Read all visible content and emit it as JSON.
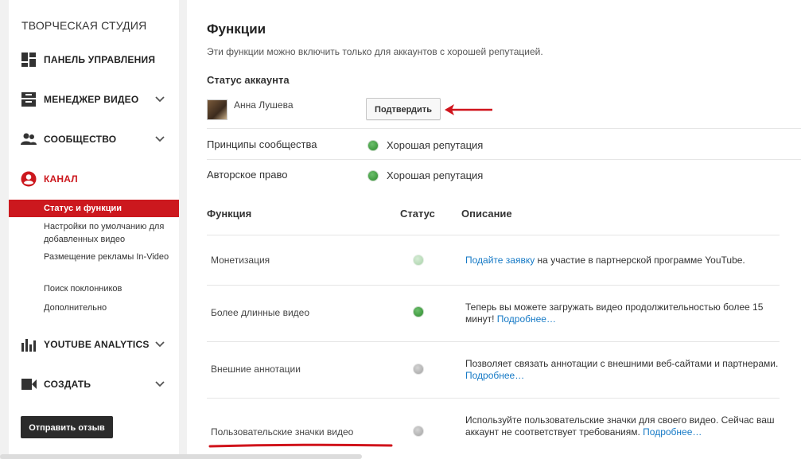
{
  "sidebar": {
    "title": "ТВОРЧЕСКАЯ СТУДИЯ",
    "items": [
      {
        "label": "ПАНЕЛЬ УПРАВЛЕНИЯ",
        "icon": "dashboard-icon"
      },
      {
        "label": "МЕНЕДЖЕР ВИДЕО",
        "icon": "video-manager-icon"
      },
      {
        "label": "СООБЩЕСТВО",
        "icon": "community-icon"
      },
      {
        "label": "КАНАЛ",
        "icon": "channel-icon"
      },
      {
        "label": "YOUTUBE ANALYTICS",
        "icon": "analytics-icon"
      },
      {
        "label": "СОЗДАТЬ",
        "icon": "create-icon"
      }
    ],
    "subitems": [
      "Статус и функции",
      "Настройки по умолчанию для добавленных видео",
      "Размещение рекламы In-Video",
      "Поиск поклонников",
      "Дополнительно"
    ],
    "feedback": "Отправить отзыв"
  },
  "main": {
    "title": "Функции",
    "description": "Эти функции можно включить только для аккаунтов с хорошей репутацией.",
    "status_heading": "Статус аккаунта",
    "user_name": "Анна Лушева",
    "confirm_label": "Подтвердить",
    "status_rows": [
      {
        "label": "Принципы сообщества",
        "value": "Хорошая репутация"
      },
      {
        "label": "Авторское право",
        "value": "Хорошая репутация"
      }
    ],
    "table_headers": [
      "Функция",
      "Статус",
      "Описание"
    ],
    "features": [
      {
        "name": "Монетизация",
        "link_pre": "Подайте заявку",
        "text": " на участие в партнерской программе YouTube.",
        "link_post": ""
      },
      {
        "name": "Более длинные видео",
        "link_pre": "",
        "text": "Теперь вы можете загружать видео продолжительностью более 15 минут! ",
        "link_post": "Подробнее…"
      },
      {
        "name": "Внешние аннотации",
        "link_pre": "",
        "text": "Позволяет связать аннотации с внешними веб-сайтами и партнерами. ",
        "link_post": "Подробнее…"
      },
      {
        "name": "Пользовательские значки видео",
        "link_pre": "",
        "text": "Используйте пользовательские значки для своего видео. Сейчас ваш аккаунт не соответствует требованиям. ",
        "link_post": "Подробнее…"
      }
    ]
  },
  "colors": {
    "accent": "#cc181e",
    "link": "#167ac6",
    "good": "#2e8b2e"
  }
}
